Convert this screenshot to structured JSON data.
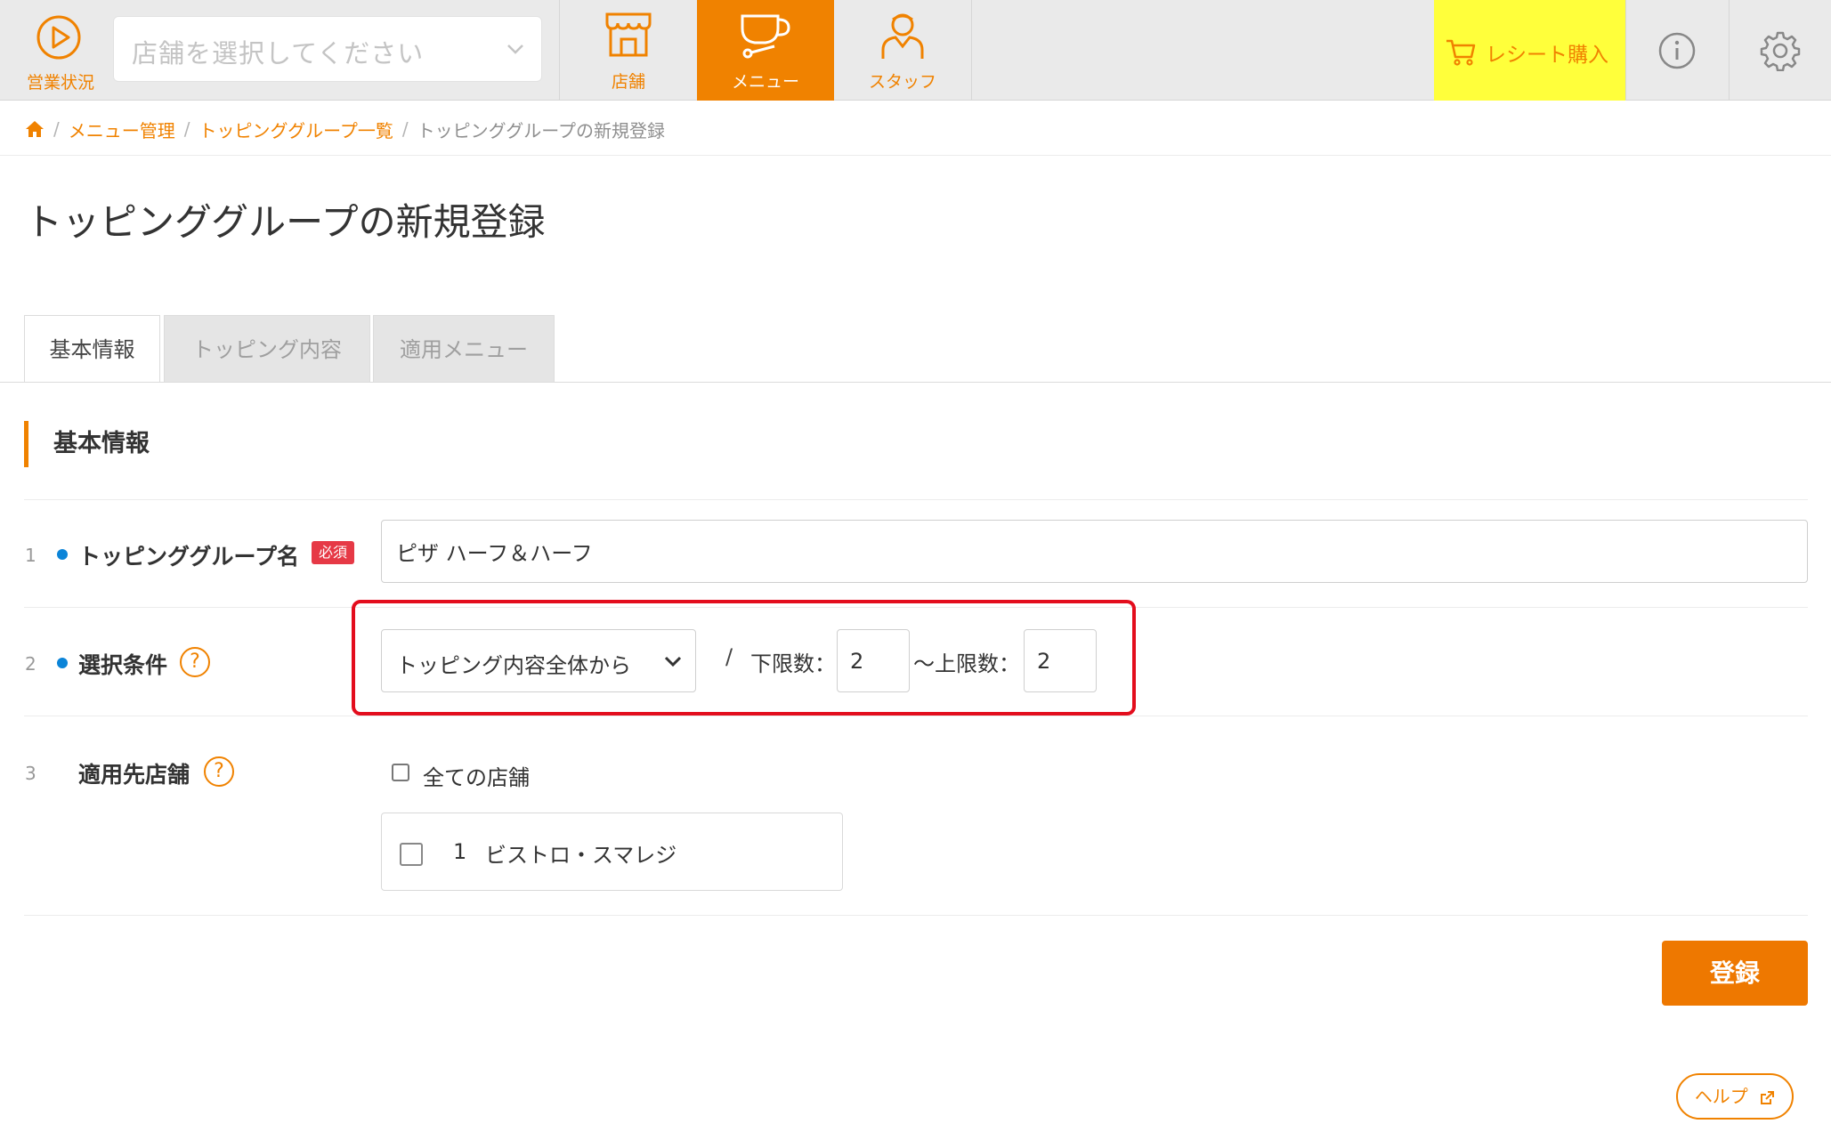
{
  "colors": {
    "accent": "#f08200",
    "highlight": "#ffff3b",
    "required": "#e63946",
    "marker": "#0b84d8",
    "annotation": "#e30d1d"
  },
  "topbar": {
    "status_label": "営業状況",
    "store_select_placeholder": "店舗を選択してください",
    "tabs": [
      {
        "label": "店舗",
        "icon": "store-icon",
        "active": false
      },
      {
        "label": "メニュー",
        "icon": "cup-icon",
        "active": true
      },
      {
        "label": "スタッフ",
        "icon": "staff-icon",
        "active": false
      }
    ],
    "receipt_label": "レシート購入",
    "info_icon": "info-icon",
    "settings_icon": "gear-icon"
  },
  "breadcrumb": {
    "home_icon": "home-icon",
    "items": [
      "メニュー管理",
      "トッピンググループ一覧"
    ],
    "current": "トッピンググループの新規登録",
    "separator": "/"
  },
  "page": {
    "title": "トッピンググループの新規登録"
  },
  "tabs": [
    {
      "label": "基本情報",
      "active": true
    },
    {
      "label": "トッピング内容",
      "active": false
    },
    {
      "label": "適用メニュー",
      "active": false
    }
  ],
  "section": {
    "heading": "基本情報"
  },
  "form": {
    "rows": [
      {
        "num": "1",
        "label": "トッピンググループ名",
        "required_badge": "必須"
      },
      {
        "num": "2",
        "label": "選択条件",
        "help": "?"
      },
      {
        "num": "3",
        "label": "適用先店舗",
        "help": "?"
      }
    ],
    "group_name_value": "ピザ ハーフ＆ハーフ",
    "selection_mode": "トッピング内容全体から",
    "slash": "/",
    "min_label": "下限数：",
    "min_value": "2",
    "max_label": "〜上限数：",
    "max_value": "2",
    "all_stores_label": "全ての店舗",
    "all_stores_checked": false,
    "stores": [
      {
        "code": "1",
        "name": "ビストロ・スマレジ",
        "checked": false
      }
    ]
  },
  "actions": {
    "register_label": "登録",
    "help_label": "ヘルプ"
  }
}
